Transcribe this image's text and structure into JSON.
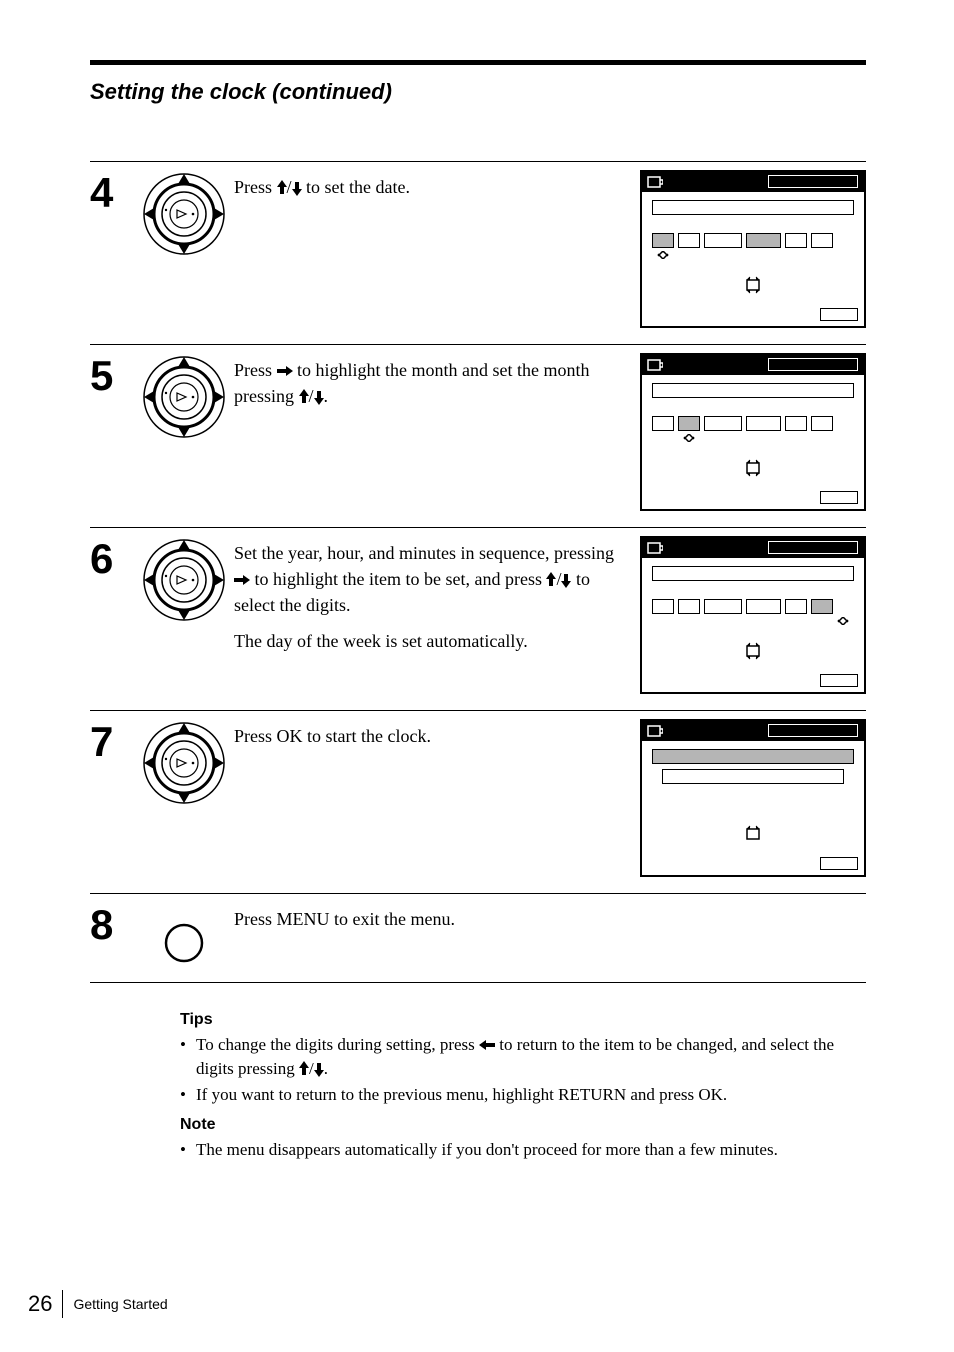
{
  "section_title": "Setting the clock (continued)",
  "steps": {
    "4": {
      "num": "4",
      "text_a": "Press ",
      "text_b": " to set the date."
    },
    "5": {
      "num": "5",
      "text_a": "Press ",
      "text_b": " to highlight the month and set the month pressing ",
      "text_c": "."
    },
    "6": {
      "num": "6",
      "text_a": "Set the year, hour, and minutes in sequence, pressing ",
      "text_b": " to highlight the item to be set, and press ",
      "text_c": " to select the digits.",
      "text_d": "The day of the week is set automatically."
    },
    "7": {
      "num": "7",
      "text": "Press OK to start the clock."
    },
    "8": {
      "num": "8",
      "text": "Press MENU to exit the menu."
    }
  },
  "tips": {
    "header": "Tips",
    "item1_a": "To change the digits during setting, press ",
    "item1_b": " to return to the item to be changed, and select the digits pressing ",
    "item1_c": ".",
    "item2": "If you want to return to the previous menu, highlight RETURN and press OK."
  },
  "note": {
    "header": "Note",
    "item1": "The menu disappears automatically if you don't proceed for more than a few minutes."
  },
  "footer": {
    "page": "26",
    "section": "Getting Started"
  },
  "icons": {
    "up_down": "↑/↓",
    "right": "→",
    "left": "←"
  }
}
